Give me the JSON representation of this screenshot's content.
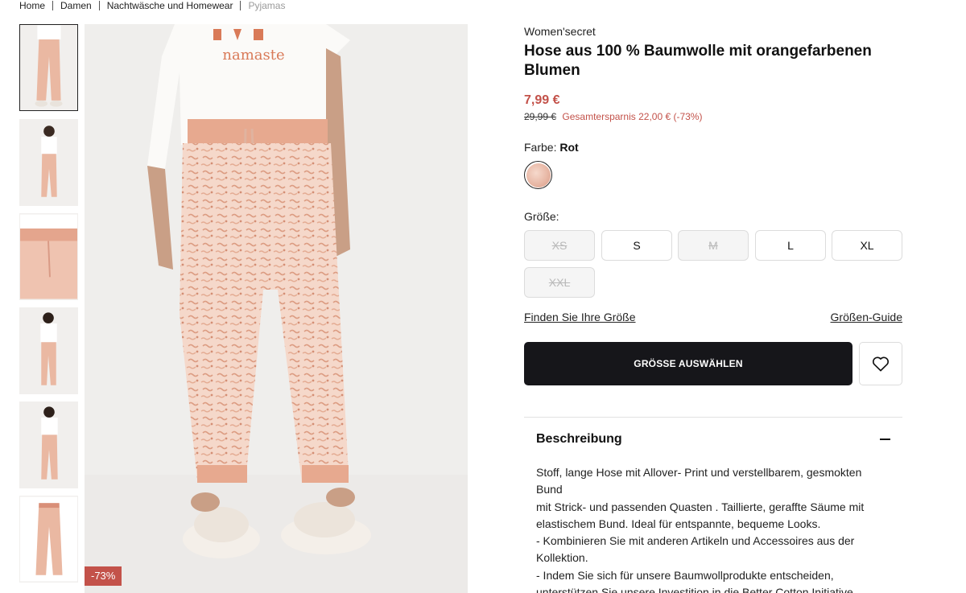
{
  "breadcrumb": {
    "items": [
      "Home",
      "Damen",
      "Nachtwäsche und Homewear",
      "Pyjamas"
    ]
  },
  "gallery": {
    "thumbnail_count": 6,
    "selected_index": 0,
    "badge": "-73%",
    "main_print": "namaste"
  },
  "product": {
    "brand": "Women'secret",
    "title": "Hose aus 100 % Baumwolle mit orangefarbenen Blumen",
    "price": "7,99 €",
    "old_price": "29,99 €",
    "savings": "Gesamtersparnis 22,00 € (-73%)",
    "color_label": "Farbe:",
    "color_value": "Rot",
    "size_label": "Größe:",
    "sizes": [
      {
        "label": "XS",
        "available": false
      },
      {
        "label": "S",
        "available": true
      },
      {
        "label": "M",
        "available": false
      },
      {
        "label": "L",
        "available": true
      },
      {
        "label": "XL",
        "available": true
      },
      {
        "label": "XXL",
        "available": false
      }
    ],
    "find_size_link": "Finden Sie Ihre Größe",
    "size_guide_link": "Größen-Guide",
    "cta_label": "GRÖSSE AUSWÄHLEN"
  },
  "description": {
    "title": "Beschreibung",
    "lines": [
      "Stoff, lange Hose mit Allover- Print und verstellbarem, gesmokten Bund",
      "mit Strick- und passenden Quasten . Taillierte, geraffte Säume mit",
      "elastischem Bund. Ideal für entspannte, bequeme Looks.",
      "- Kombinieren Sie mit anderen Artikeln und Accessoires aus der",
      "Kollektion.",
      "- Indem Sie sich für unsere Baumwollprodukte entscheiden,",
      "unterstützen Sie unsere Investition in die Better Cotton Initiative."
    ]
  },
  "colors": {
    "accent": "#c3524a",
    "cta": "#16161a",
    "pants": "#eab8a2"
  }
}
